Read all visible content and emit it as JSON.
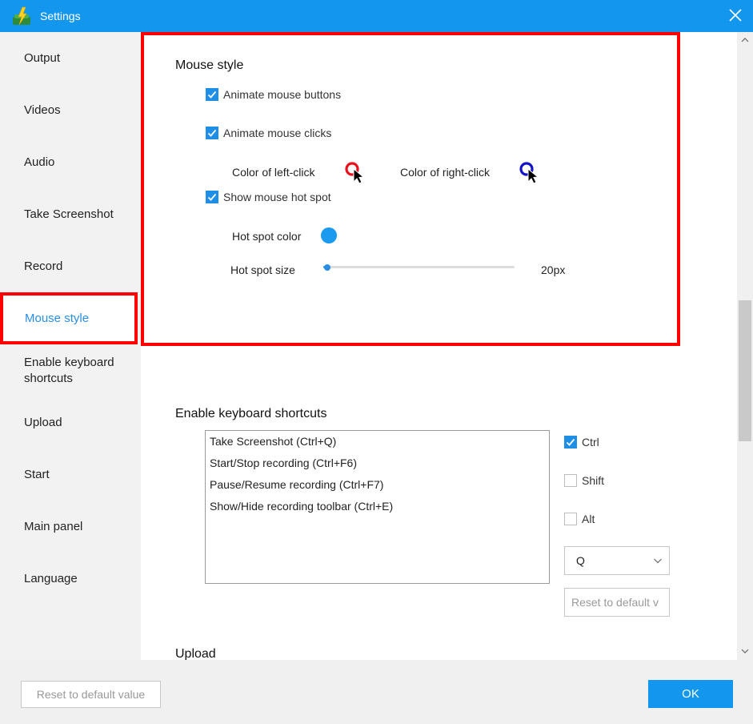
{
  "window": {
    "title": "Settings"
  },
  "sidebar": {
    "items": [
      {
        "label": "Output"
      },
      {
        "label": "Videos"
      },
      {
        "label": "Audio"
      },
      {
        "label": "Take Screenshot"
      },
      {
        "label": "Record"
      },
      {
        "label": "Mouse style",
        "active": true
      },
      {
        "label": "Enable keyboard shortcuts"
      },
      {
        "label": "Upload"
      },
      {
        "label": "Start"
      },
      {
        "label": "Main panel"
      },
      {
        "label": "Language"
      }
    ]
  },
  "mouse_style": {
    "title": "Mouse style",
    "animate_buttons": {
      "label": "Animate mouse buttons",
      "checked": true
    },
    "animate_clicks": {
      "label": "Animate mouse clicks",
      "checked": true
    },
    "left_click_color": {
      "label": "Color of left-click",
      "color": "#e8101e"
    },
    "right_click_color": {
      "label": "Color of right-click",
      "color": "#1212c8"
    },
    "show_hot_spot": {
      "label": "Show mouse hot spot",
      "checked": true
    },
    "hot_spot_color": {
      "label": "Hot spot color",
      "color": "#1a9bf0"
    },
    "hot_spot_size": {
      "label": "Hot spot size",
      "value_text": "20px",
      "fraction": 0.02
    }
  },
  "keyboard_shortcuts": {
    "title": "Enable keyboard shortcuts",
    "list": [
      "Take Screenshot (Ctrl+Q)",
      "Start/Stop recording (Ctrl+F6)",
      "Pause/Resume recording (Ctrl+F7)",
      "Show/Hide recording toolbar (Ctrl+E)"
    ],
    "modifiers": {
      "ctrl": {
        "label": "Ctrl",
        "checked": true
      },
      "shift": {
        "label": "Shift",
        "checked": false
      },
      "alt": {
        "label": "Alt",
        "checked": false
      }
    },
    "key_select": {
      "value": "Q"
    },
    "reset_label": "Reset to default v"
  },
  "upload": {
    "title": "Upload"
  },
  "footer": {
    "reset_label": "Reset to default value",
    "ok_label": "OK"
  },
  "colors": {
    "accent": "#1296ee",
    "highlight": "#ff0000"
  }
}
